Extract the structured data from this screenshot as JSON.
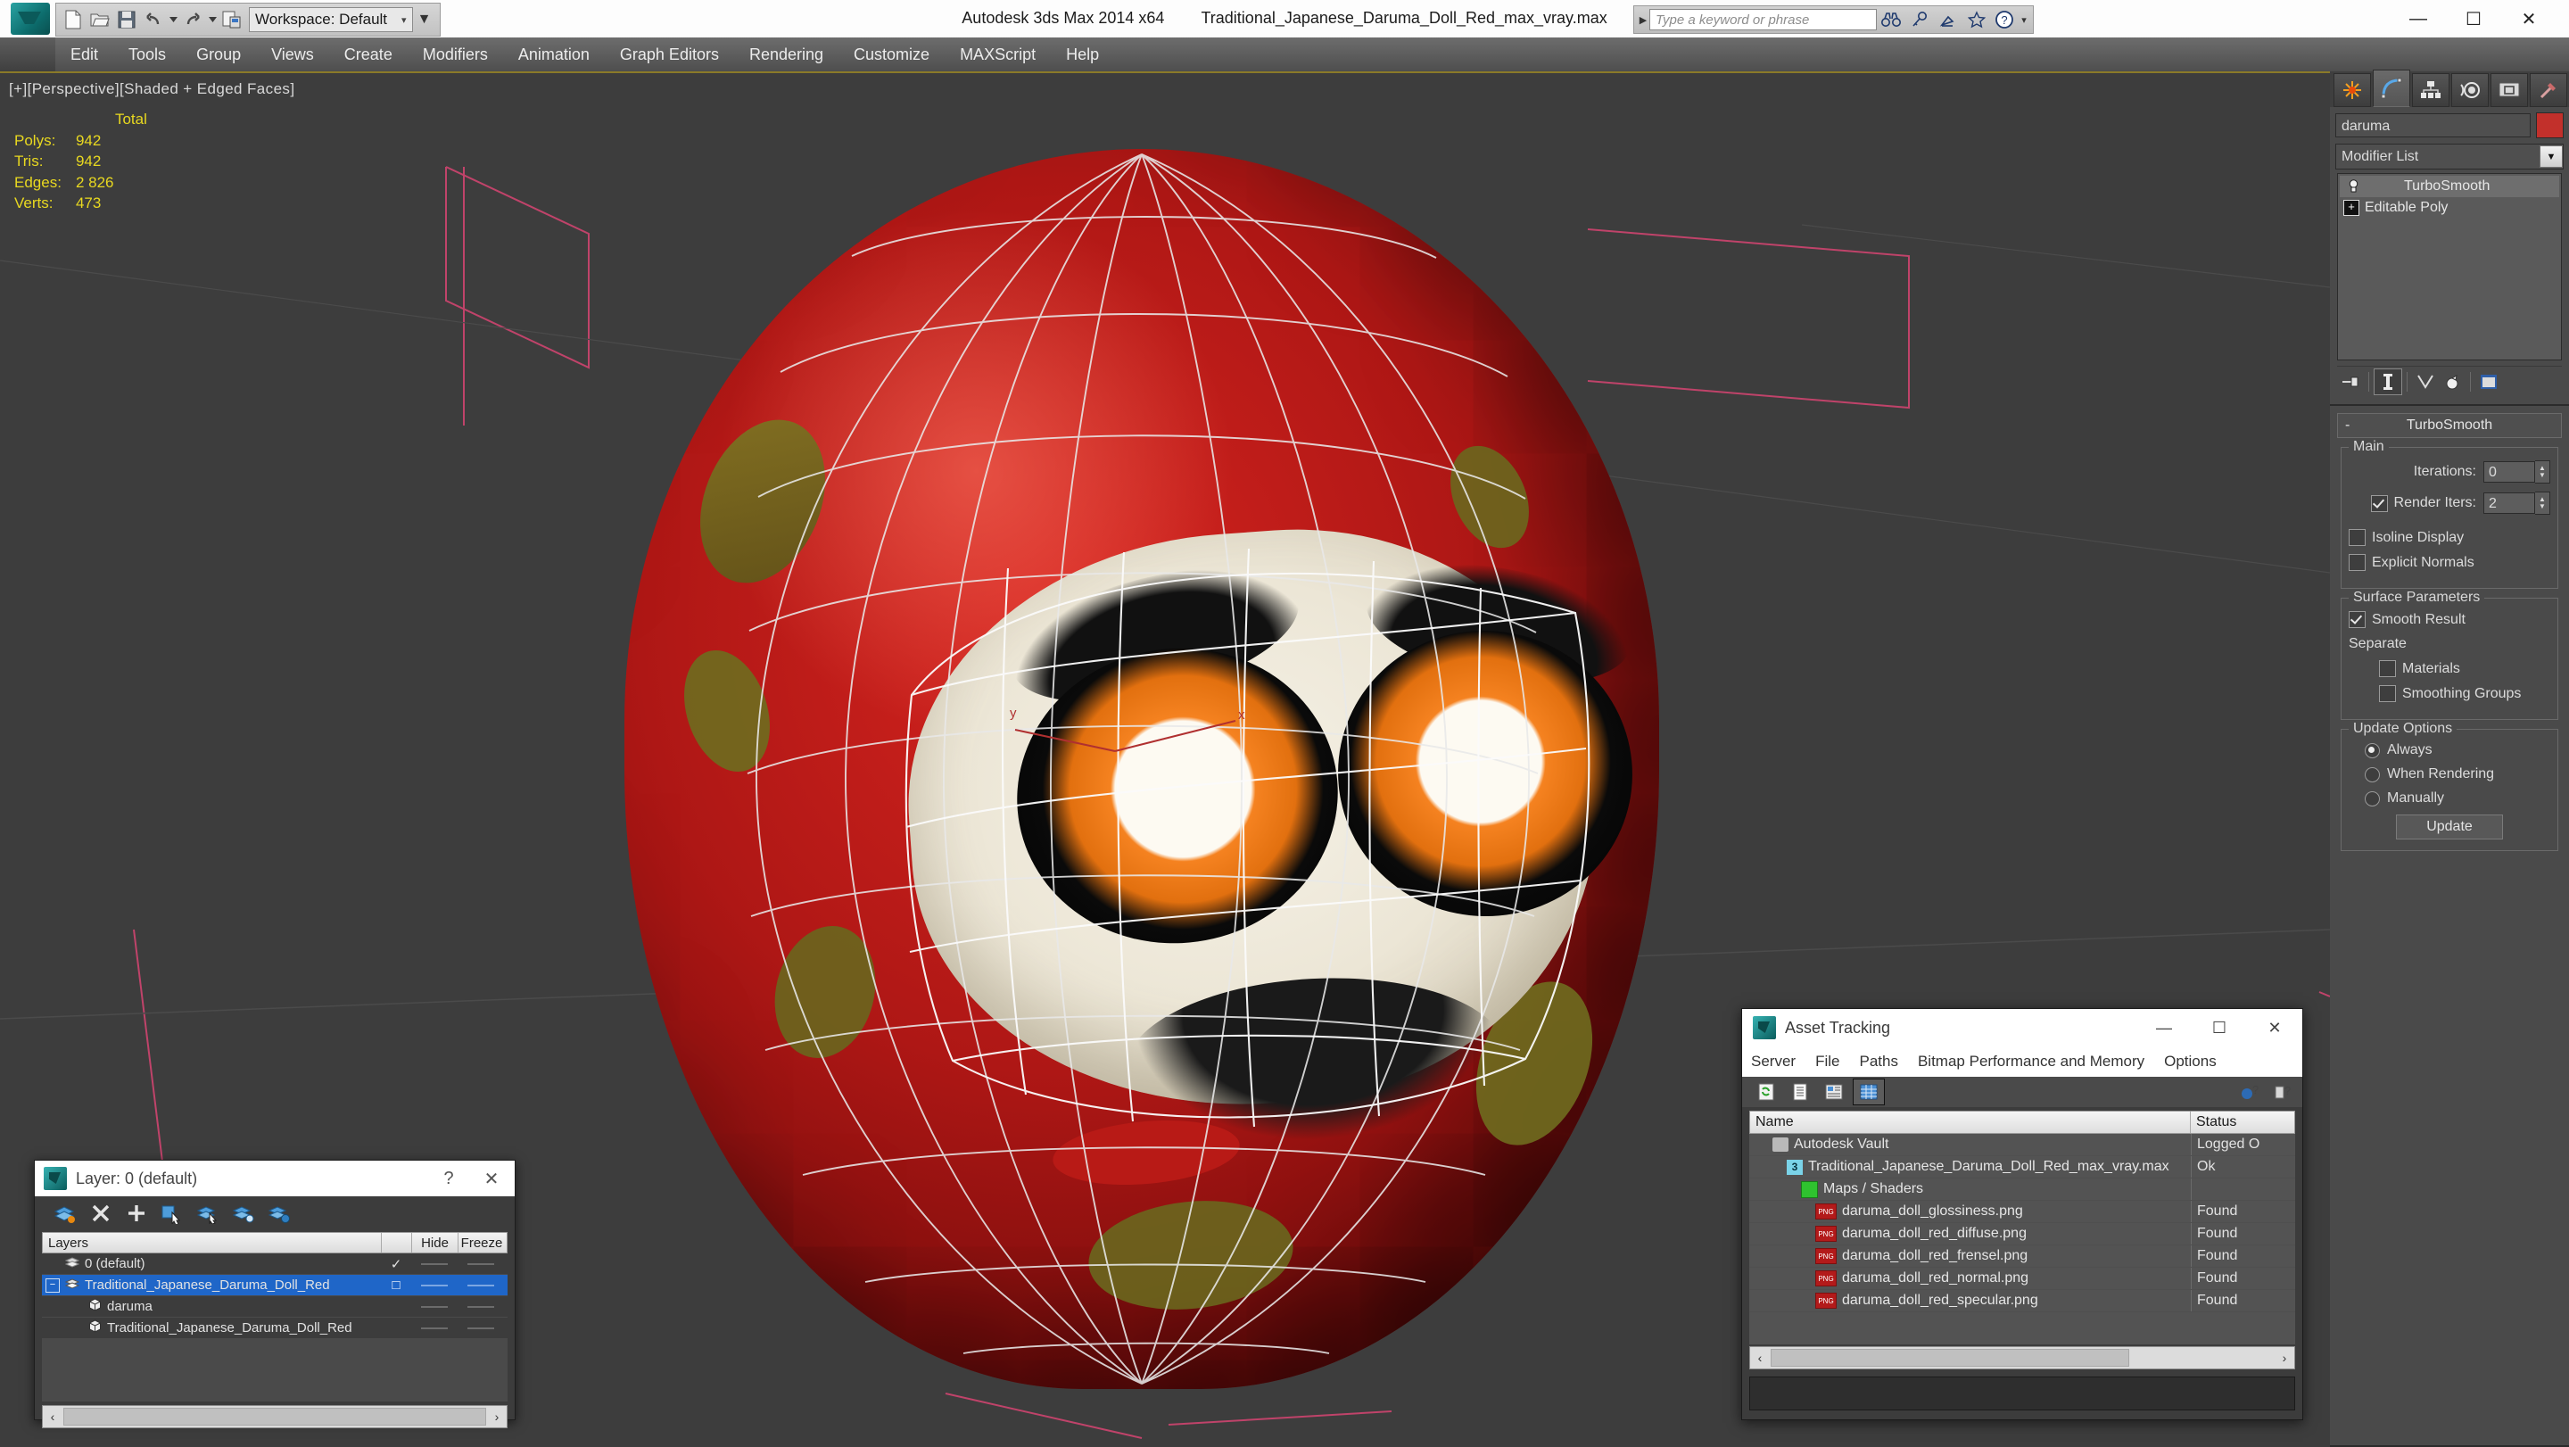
{
  "titlebar": {
    "app_title": "Autodesk 3ds Max  2014 x64",
    "file_title": "Traditional_Japanese_Daruma_Doll_Red_max_vray.max",
    "workspace": "Workspace: Default",
    "search_placeholder": "Type a keyword or phrase",
    "minimize": "—",
    "maximize": "☐",
    "close": "✕"
  },
  "menu": {
    "items": [
      "Edit",
      "Tools",
      "Group",
      "Views",
      "Create",
      "Modifiers",
      "Animation",
      "Graph Editors",
      "Rendering",
      "Customize",
      "MAXScript",
      "Help"
    ]
  },
  "viewport": {
    "label": "[+][Perspective][Shaded + Edged Faces]",
    "stats": {
      "header": "Total",
      "rows": [
        {
          "label": "Polys:",
          "value": "942"
        },
        {
          "label": "Tris:",
          "value": "942"
        },
        {
          "label": "Edges:",
          "value": "2 826"
        },
        {
          "label": "Verts:",
          "value": "473"
        }
      ]
    }
  },
  "command_panel": {
    "tabs": [
      "create-tab",
      "modify-tab",
      "hierarchy-tab",
      "motion-tab",
      "display-tab",
      "utilities-tab"
    ],
    "selected_tab_index": 1,
    "object_name": "daruma",
    "object_color": "#c2302b",
    "modifier_list_label": "Modifier List",
    "stack": [
      {
        "label": "TurboSmooth",
        "selected": true
      },
      {
        "label": "Editable Poly",
        "selected": false
      }
    ],
    "rollout": {
      "title": "TurboSmooth",
      "collapse_glyph": "-",
      "main": {
        "group_title": "Main",
        "iterations_label": "Iterations:",
        "iterations_value": "0",
        "render_iters_label": "Render Iters:",
        "render_iters_value": "2",
        "render_iters_checked": true,
        "isoline_label": "Isoline Display",
        "isoline_checked": false,
        "explicit_label": "Explicit Normals",
        "explicit_checked": false
      },
      "surface": {
        "group_title": "Surface Parameters",
        "smooth_result_label": "Smooth Result",
        "smooth_result_checked": true,
        "separate_label": "Separate",
        "materials_label": "Materials",
        "materials_checked": false,
        "smoothing_groups_label": "Smoothing Groups",
        "smoothing_groups_checked": false
      },
      "update": {
        "group_title": "Update Options",
        "options": [
          {
            "label": "Always",
            "selected": true
          },
          {
            "label": "When Rendering",
            "selected": false
          },
          {
            "label": "Manually",
            "selected": false
          }
        ],
        "button_label": "Update"
      }
    }
  },
  "layer_dialog": {
    "title": "Layer: 0 (default)",
    "help_glyph": "?",
    "close_glyph": "✕",
    "toolbar": [
      "new-layer-icon",
      "delete-layer-icon",
      "add-layer-icon",
      "select-objects-icon",
      "select-highlighted-icon",
      "highlight-selected-icon",
      "layer-settings-icon"
    ],
    "columns": [
      "Layers",
      "",
      "Hide",
      "Freeze"
    ],
    "rows": [
      {
        "name": "0 (default)",
        "indent": 1,
        "current": "✓",
        "hide": "——",
        "freeze": "——",
        "selected": false,
        "type": "layer"
      },
      {
        "name": "Traditional_Japanese_Daruma_Doll_Red",
        "indent": 0,
        "current": "□",
        "hide": "——",
        "freeze": "——",
        "selected": true,
        "type": "layer"
      },
      {
        "name": "daruma",
        "indent": 2,
        "current": "",
        "hide": "——",
        "freeze": "——",
        "selected": false,
        "type": "object"
      },
      {
        "name": "Traditional_Japanese_Daruma_Doll_Red",
        "indent": 2,
        "current": "",
        "hide": "——",
        "freeze": "——",
        "selected": false,
        "type": "object"
      }
    ],
    "scroll_left": "‹",
    "scroll_right": "›"
  },
  "asset_tracking": {
    "title": "Asset Tracking",
    "minimize": "—",
    "maximize": "☐",
    "close": "✕",
    "menu": [
      "Server",
      "File",
      "Paths",
      "Bitmap Performance and Memory",
      "Options"
    ],
    "toolbar": [
      "refresh-icon",
      "list-view-icon",
      "detail-view-icon",
      "grid-view-icon"
    ],
    "right_icons": [
      "add-help-icon",
      "help-icon"
    ],
    "columns": {
      "name": "Name",
      "status": "Status"
    },
    "rows": [
      {
        "name": "Autodesk Vault",
        "status": "Logged O",
        "indent": 1,
        "icon": "vault-icon"
      },
      {
        "name": "Traditional_Japanese_Daruma_Doll_Red_max_vray.max",
        "status": "Ok",
        "indent": 2,
        "icon": "max-file-icon"
      },
      {
        "name": "Maps / Shaders",
        "status": "",
        "indent": 3,
        "icon": "maps-icon"
      },
      {
        "name": "daruma_doll_glossiness.png",
        "status": "Found",
        "indent": 4,
        "icon": "png-icon"
      },
      {
        "name": "daruma_doll_red_diffuse.png",
        "status": "Found",
        "indent": 4,
        "icon": "png-icon"
      },
      {
        "name": "daruma_doll_red_frensel.png",
        "status": "Found",
        "indent": 4,
        "icon": "png-icon"
      },
      {
        "name": "daruma_doll_red_normal.png",
        "status": "Found",
        "indent": 4,
        "icon": "png-icon"
      },
      {
        "name": "daruma_doll_red_specular.png",
        "status": "Found",
        "indent": 4,
        "icon": "png-icon"
      }
    ],
    "scroll_left": "‹",
    "scroll_right": "›"
  }
}
